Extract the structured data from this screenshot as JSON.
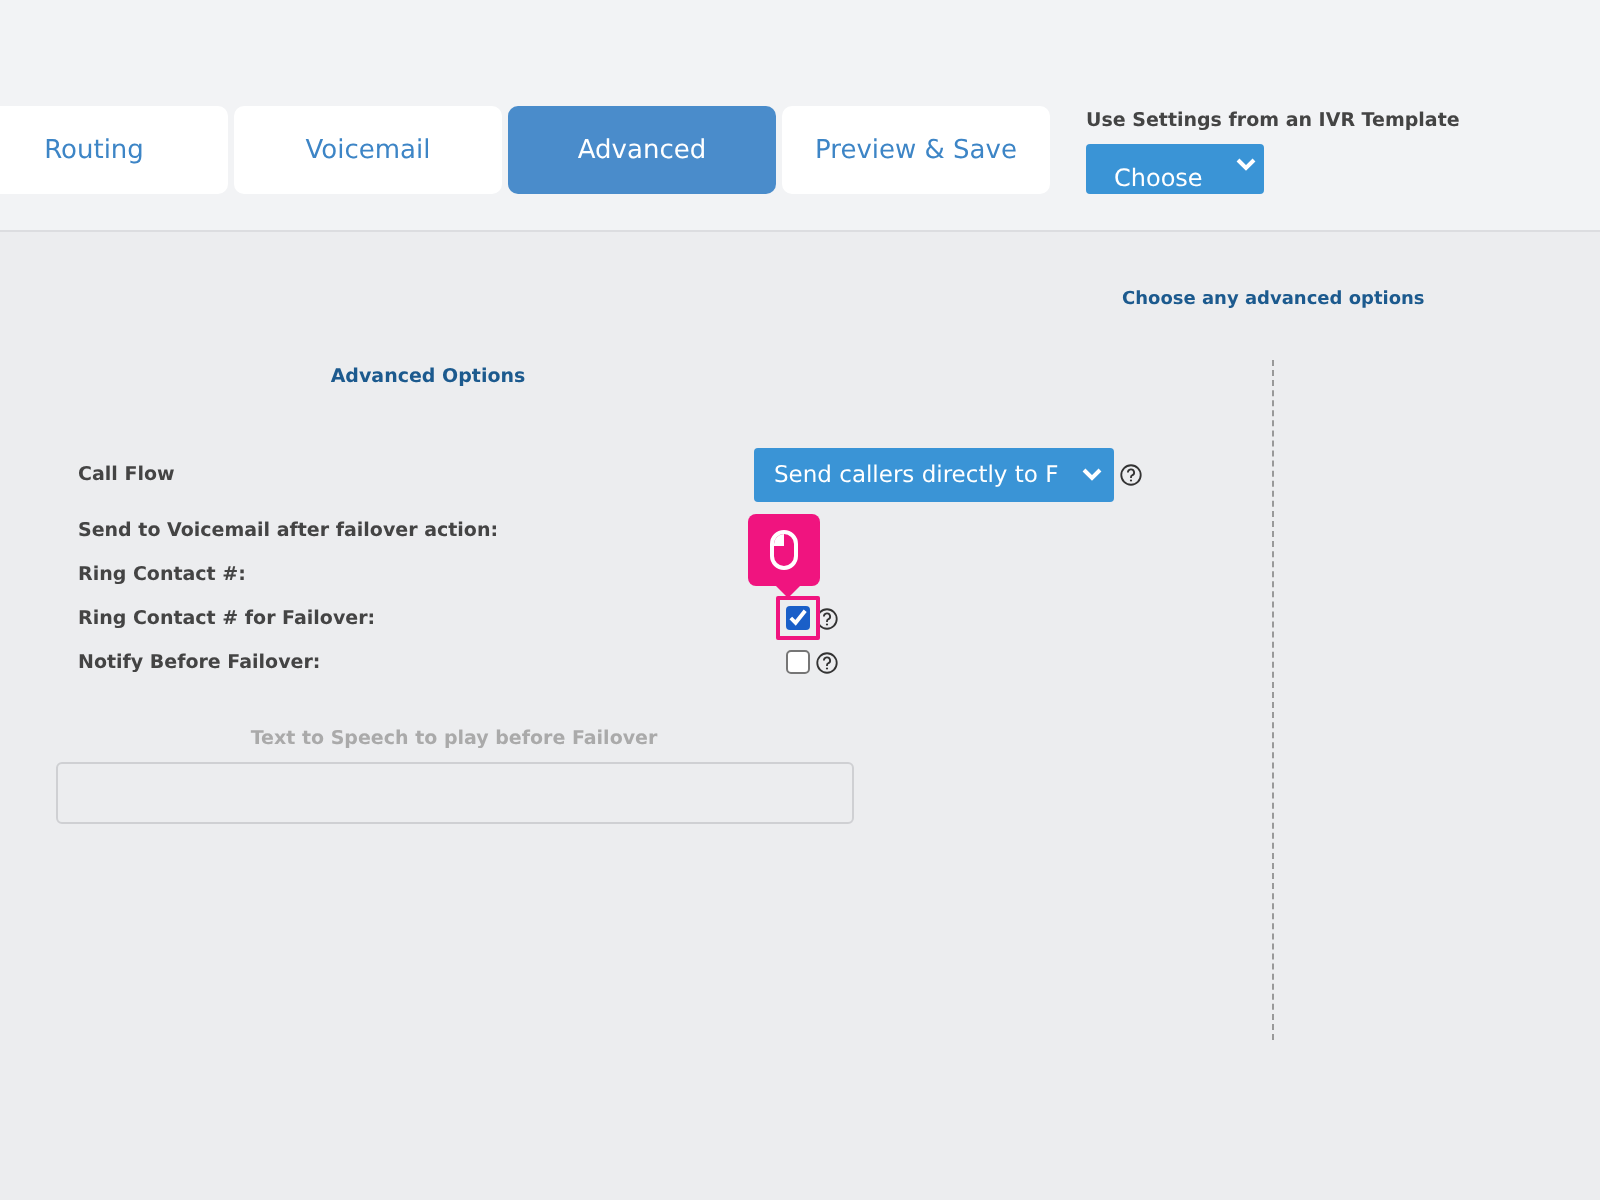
{
  "tabs": [
    {
      "label": "Routing",
      "selected": false
    },
    {
      "label": "Voicemail",
      "selected": false
    },
    {
      "label": "Advanced",
      "selected": true
    },
    {
      "label": "Preview & Save",
      "selected": false
    }
  ],
  "template": {
    "label": "Use Settings from an IVR Template",
    "value": "Choose"
  },
  "hint": "Choose any advanced options",
  "section_title": "Advanced Options",
  "rows": [
    {
      "kind": "select",
      "label": "Call Flow",
      "value": "Send callers directly to F",
      "help": true
    },
    {
      "kind": "plain",
      "label": "Send to Voicemail after failover action:"
    },
    {
      "kind": "plain",
      "label": "Ring Contact #:"
    },
    {
      "kind": "checkbox",
      "label": "Ring Contact # for Failover:",
      "checked": true,
      "help": true,
      "clicked": true
    },
    {
      "kind": "checkbox",
      "label": "Notify Before Failover:",
      "checked": false,
      "help": true
    }
  ],
  "tts": {
    "label": "Text to Speech to play before Failover"
  }
}
